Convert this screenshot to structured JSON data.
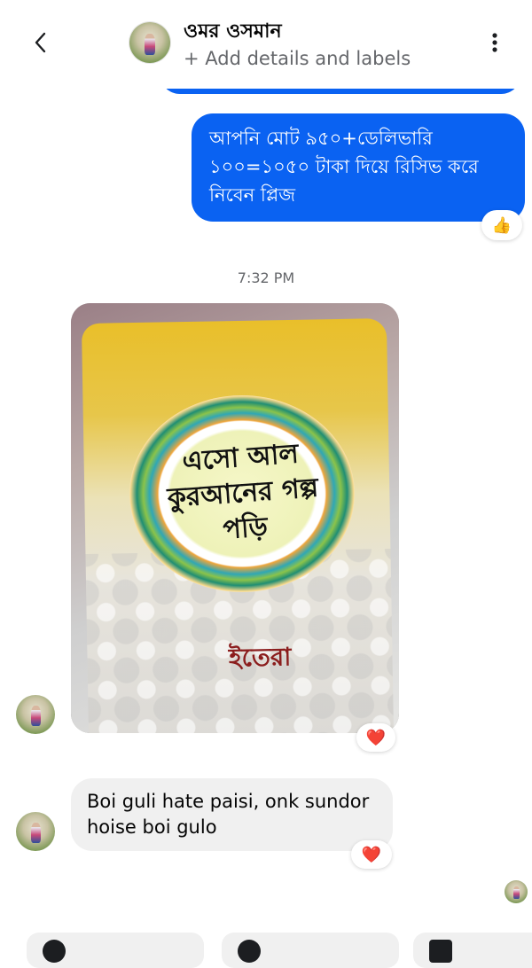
{
  "header": {
    "contact_name": "ওমর ওসমান",
    "subtitle": "+ Add details and labels",
    "back_icon": "chevron-left-icon",
    "more_icon": "more-vertical-icon"
  },
  "messages": {
    "outgoing_text": "আপনি মোট ৯৫০+ডেলিভারি ১০০=১০৫০ টাকা দিয়ে রিসিভ করে নিবেন প্লিজ",
    "outgoing_reaction": "👍",
    "timestamp": "7:32 PM",
    "photo_reaction": "❤️",
    "incoming_text": "Boi guli hate paisi, onk sundor hoise boi gulo",
    "incoming_reaction": "❤️"
  },
  "photo_content": {
    "cover_title": "এসো আল কুরআনের গল্প পড়ি",
    "publisher_logo": "ইতেরা"
  },
  "colors": {
    "outgoing_bubble": "#0a62f2",
    "incoming_bubble": "#f0f0f0",
    "timestamp": "#65676b"
  }
}
